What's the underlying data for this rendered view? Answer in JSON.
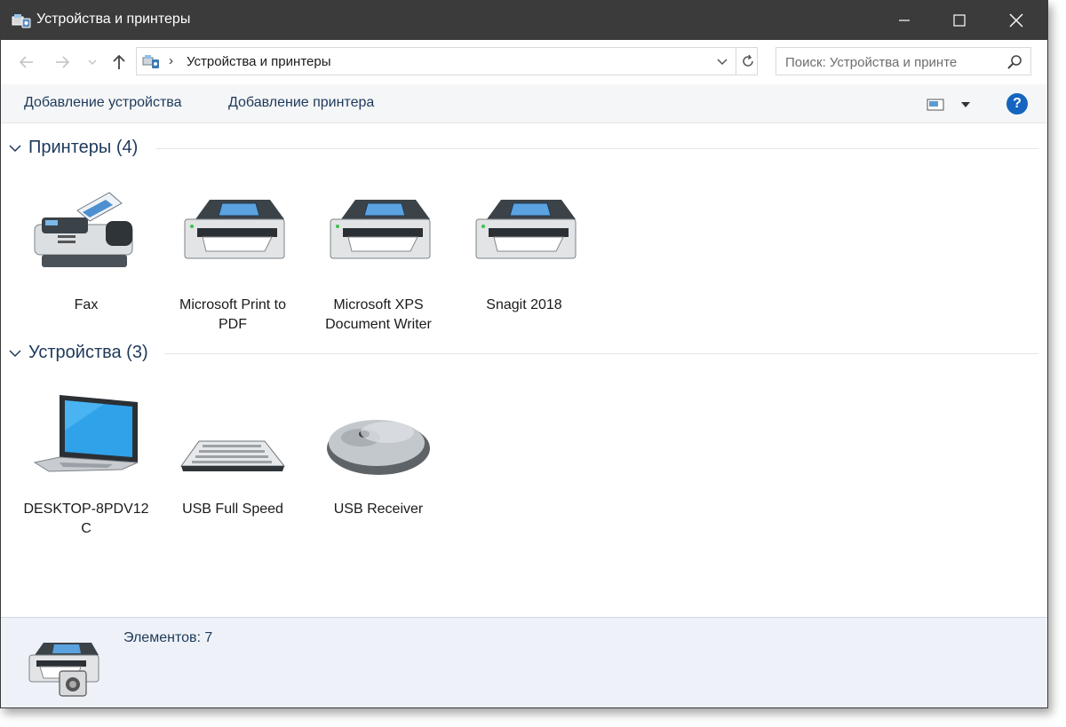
{
  "window": {
    "title": "Устройства и принтеры"
  },
  "nav": {
    "path_label": "Устройства и принтеры",
    "search_placeholder": "Поиск: Устройства и принте"
  },
  "commands": {
    "add_device": "Добавление устройства",
    "add_printer": "Добавление принтера"
  },
  "groups": {
    "printers": {
      "title": "Принтеры (4)",
      "items": [
        {
          "label": "Fax",
          "icon": "fax-icon"
        },
        {
          "label": "Microsoft Print to PDF",
          "icon": "printer-icon"
        },
        {
          "label": "Microsoft XPS Document Writer",
          "icon": "printer-icon"
        },
        {
          "label": "Snagit 2018",
          "icon": "printer-icon"
        }
      ]
    },
    "devices": {
      "title": "Устройства (3)",
      "items": [
        {
          "label": "DESKTOP-8PDV12C",
          "icon": "laptop-icon"
        },
        {
          "label": "USB Full Speed",
          "icon": "keyboard-icon"
        },
        {
          "label": "USB Receiver",
          "icon": "mouse-icon"
        }
      ]
    }
  },
  "details": {
    "count_text": "Элементов: 7"
  },
  "colors": {
    "accent": "#1e395b",
    "titlebar": "#3b3b3b",
    "help": "#1565c0"
  }
}
